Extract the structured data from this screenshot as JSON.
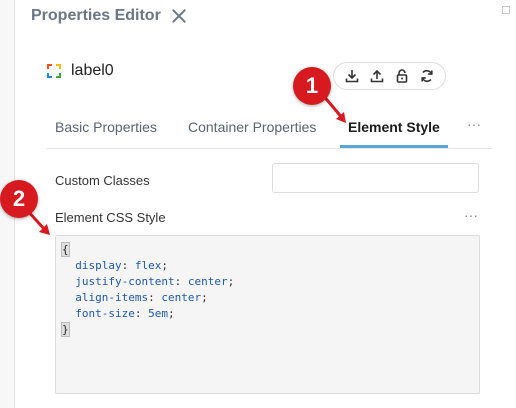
{
  "panel": {
    "title": "Properties Editor",
    "close_icon": "close-icon"
  },
  "component": {
    "name": "label0",
    "icon": "component-icon",
    "actions": [
      "download-icon",
      "upload-icon",
      "unlock-icon",
      "sync-icon"
    ]
  },
  "tabs": [
    {
      "label": "Basic Properties",
      "active": false
    },
    {
      "label": "Container Properties",
      "active": false
    },
    {
      "label": "Element Style",
      "active": true
    }
  ],
  "tabs_more": "···",
  "fields": {
    "custom_classes_label": "Custom Classes",
    "custom_classes_value": "",
    "css_style_label": "Element CSS Style",
    "css_more": "···"
  },
  "css_code": [
    {
      "type": "brace",
      "text": "{"
    },
    {
      "type": "decl",
      "prop": "display",
      "value": "flex"
    },
    {
      "type": "decl",
      "prop": "justify-content",
      "value": "center"
    },
    {
      "type": "decl",
      "prop": "align-items",
      "value": "center"
    },
    {
      "type": "decl",
      "prop": "font-size",
      "value": "5em"
    },
    {
      "type": "brace",
      "text": "}"
    }
  ],
  "annotations": [
    {
      "number": "1"
    },
    {
      "number": "2"
    }
  ],
  "colors": {
    "accent": "#5aa7d6",
    "badge": "#d71920"
  }
}
